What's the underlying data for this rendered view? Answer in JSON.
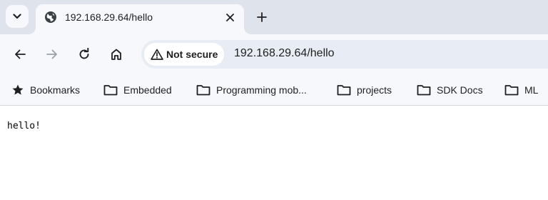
{
  "tab": {
    "title": "192.168.29.64/hello",
    "favicon": "globe-icon",
    "close_icon": "close-icon"
  },
  "tab_search_icon": "chevron-down-icon",
  "new_tab_icon": "plus-icon",
  "toolbar": {
    "back_icon": "arrow-left-icon",
    "forward_icon": "arrow-right-icon",
    "reload_icon": "reload-icon",
    "home_icon": "home-icon"
  },
  "omnibox": {
    "security_label": "Not secure",
    "security_icon": "warning-icon",
    "url": "192.168.29.64/hello"
  },
  "bookmarks": [
    {
      "label": "Bookmarks",
      "icon": "star-icon"
    },
    {
      "label": "Embedded",
      "icon": "folder-icon"
    },
    {
      "label": "Programming mob...",
      "icon": "folder-icon"
    },
    {
      "label": "projects",
      "icon": "folder-icon"
    },
    {
      "label": "SDK Docs",
      "icon": "folder-icon"
    },
    {
      "label": "ML",
      "icon": "folder-icon"
    }
  ],
  "page": {
    "body_text": "hello!"
  },
  "colors": {
    "tabstrip_bg": "#dfe3eb",
    "toolbar_bg": "#f6f8fc",
    "omnibox_bg": "#e8ecf4",
    "text": "#1f1f1f"
  }
}
